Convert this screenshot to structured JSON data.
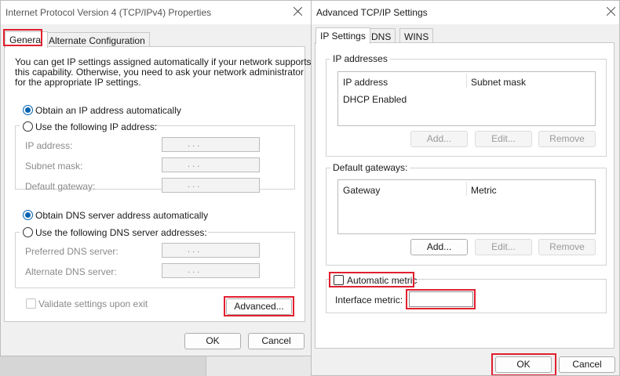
{
  "ipv4_dialog": {
    "title": "Internet Protocol Version 4 (TCP/IPv4) Properties",
    "tabs": [
      "General",
      "Alternate Configuration"
    ],
    "description": [
      "You can get IP settings assigned automatically if your network supports",
      "this capability. Otherwise, you need to ask your network administrator",
      "for the appropriate IP settings."
    ],
    "obtain_ip_auto": "Obtain an IP address automatically",
    "use_following_ip": "Use the following IP address:",
    "ip_fields": [
      "IP address:",
      "Subnet mask:",
      "Default gateway:"
    ],
    "obtain_dns_auto": "Obtain DNS server address automatically",
    "use_following_dns": "Use the following DNS server addresses:",
    "dns_fields": [
      "Preferred DNS server:",
      "Alternate DNS server:"
    ],
    "ip_dots": ".   .   .",
    "validate": "Validate settings upon exit",
    "advanced": "Advanced...",
    "ok": "OK",
    "cancel": "Cancel"
  },
  "advanced_dialog": {
    "title": "Advanced TCP/IP Settings",
    "tabs": [
      "IP Settings",
      "DNS",
      "WINS"
    ],
    "ip_addresses": {
      "legend": "IP addresses",
      "columns": [
        "IP address",
        "Subnet mask"
      ],
      "rows": [
        "DHCP Enabled"
      ],
      "buttons": [
        "Add...",
        "Edit...",
        "Remove"
      ]
    },
    "gateways": {
      "legend": "Default gateways:",
      "columns": [
        "Gateway",
        "Metric"
      ],
      "buttons": [
        "Add...",
        "Edit...",
        "Remove"
      ]
    },
    "automatic_metric": "Automatic metric",
    "interface_metric": "Interface metric:",
    "interface_metric_value": "",
    "ok": "OK",
    "cancel": "Cancel"
  }
}
